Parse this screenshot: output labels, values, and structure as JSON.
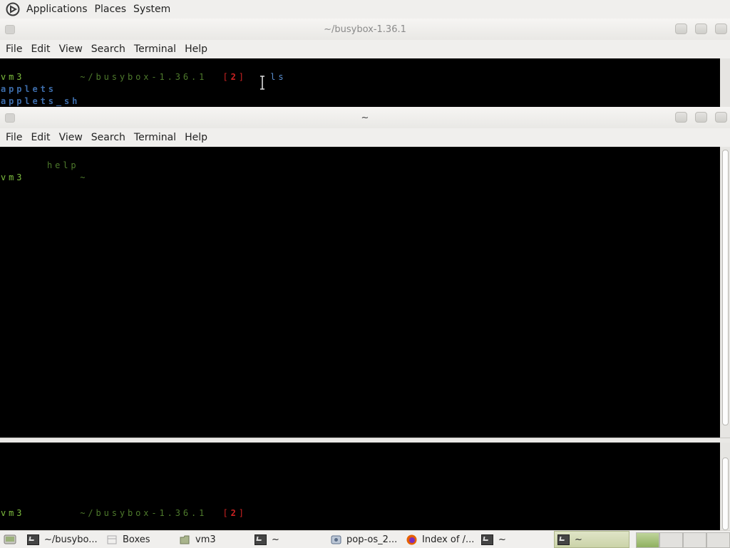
{
  "top_panel": {
    "menus": [
      "Applications",
      "Places",
      "System"
    ]
  },
  "window_back": {
    "title": "~/busybox-1.36.1",
    "menu": [
      "File",
      "Edit",
      "View",
      "Search",
      "Terminal",
      "Help"
    ],
    "lines": [
      {
        "host": "vm3",
        "path": "~/busybox-1.36.1",
        "badge_open": "[",
        "badge_num": "2",
        "badge_close": "]",
        "cmd": "ls"
      },
      {
        "text": "applets"
      },
      {
        "text": "applets_sh"
      }
    ],
    "bottom_prompt": {
      "host": "vm3",
      "path": "~/busybox-1.36.1",
      "badge_open": "[",
      "badge_num": "2",
      "badge_close": "]"
    }
  },
  "window_front": {
    "title": "~",
    "menu": [
      "File",
      "Edit",
      "View",
      "Search",
      "Terminal",
      "Help"
    ],
    "lines": [
      {
        "text": "help"
      },
      {
        "host": "vm3",
        "path": "~"
      }
    ]
  },
  "taskbar": {
    "items": [
      {
        "icon": "terminal-icon",
        "label": "~/busybo..."
      },
      {
        "icon": "boxes-icon",
        "label": "Boxes"
      },
      {
        "icon": "folder-icon",
        "label": "vm3"
      },
      {
        "icon": "terminal-icon",
        "label": "~"
      },
      {
        "icon": "disk-icon",
        "label": "pop-os_2..."
      },
      {
        "icon": "firefox-icon",
        "label": "Index of /..."
      },
      {
        "icon": "terminal-icon",
        "label": "~"
      },
      {
        "icon": "terminal-icon",
        "label": "~"
      }
    ]
  },
  "colors": {
    "prompt_green": "#7fbf3f",
    "path_green": "#4e7a2c",
    "badge_red": "#cc2222",
    "listing_blue": "#3d6dab"
  }
}
